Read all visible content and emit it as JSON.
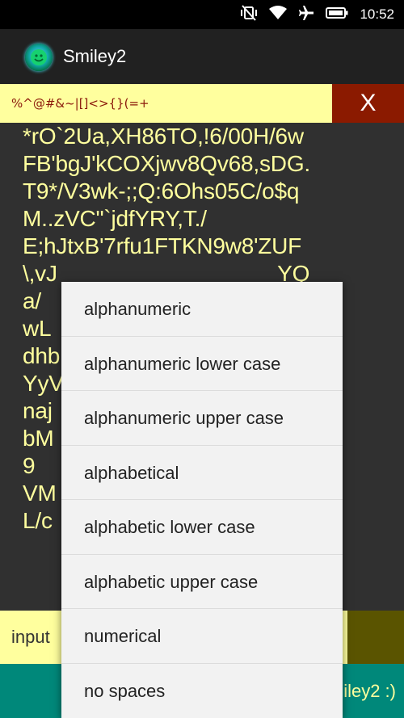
{
  "status_bar": {
    "time": "10:52",
    "icons": [
      "vibrate-off-icon",
      "wifi-icon",
      "airplane-icon",
      "battery-icon"
    ]
  },
  "app_bar": {
    "title": "Smiley2",
    "icon": "smiley-app-icon"
  },
  "top_row": {
    "pattern": "%^@#&~|[]<>{}(=+",
    "close_label": "X"
  },
  "generated_text": {
    "lines": [
      "*rO`2Ua,XH86TO,!6/00H/6w",
      "FB'bgJ'kCOXjwv8Qv68,sDG.",
      "T9*/V3wk-;;Q:6Ohs05C/o$q",
      "M..zVC\"`jdfYRY,T./",
      "E;hJtxB'7rfu1FTKN9w8'ZUF",
      "\\,vJ                                    YQ",
      "a/",
      "wL                                  Ldc",
      "dhb                                  _i0",
      "YyV                                  7,n",
      "naj",
      "bM                                    l?$",
      "9",
      "VM                                    P3",
      "L/c"
    ]
  },
  "input": {
    "text": "input"
  },
  "footer": {
    "text": "iley2 :)"
  },
  "dropdown": {
    "options": [
      "alphanumeric",
      "alphanumeric lower case",
      "alphanumeric upper case",
      "alphabetical",
      "alphabetic lower case",
      "alphabetic upper case",
      "numerical",
      "no spaces"
    ]
  },
  "colors": {
    "accent_yellow": "#ffff9e",
    "close_red": "#8b1a00",
    "teal": "#00887a",
    "olive": "#5a5400",
    "background": "#303030"
  }
}
